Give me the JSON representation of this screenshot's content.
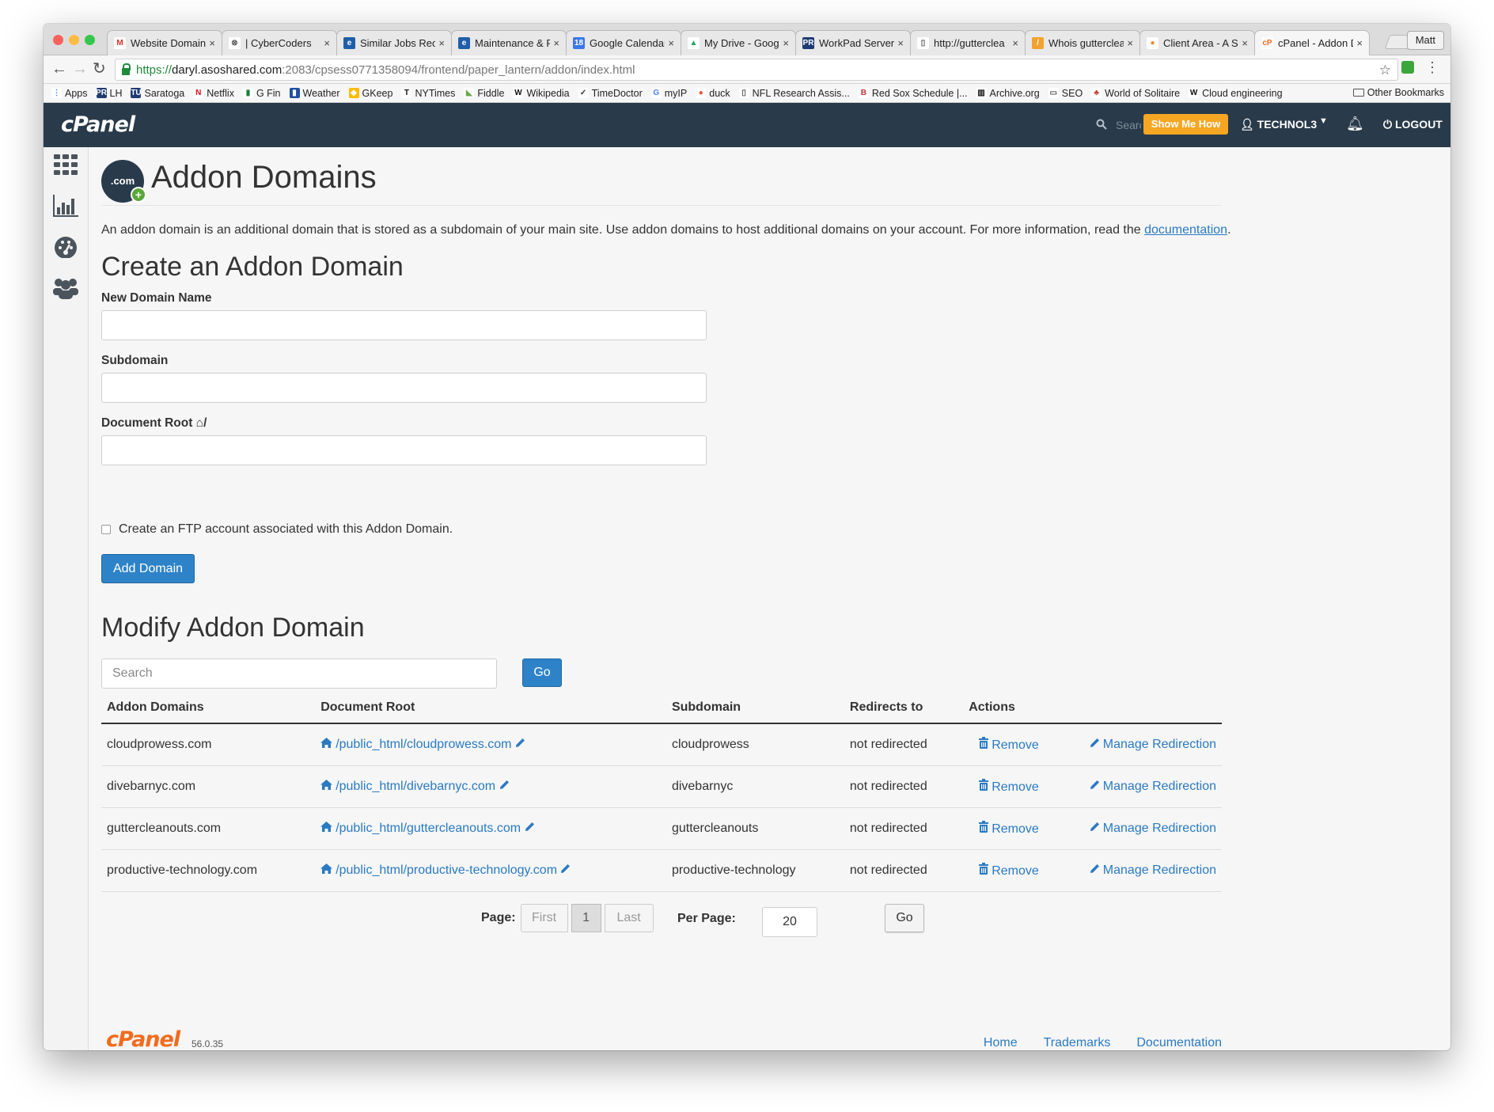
{
  "browser": {
    "tabs": [
      {
        "title": "Website Domain",
        "icon_text": "M",
        "icon_bg": "#ffffff",
        "icon_color": "#d93025"
      },
      {
        "title": "| CyberCoders",
        "icon_text": "⊗",
        "icon_bg": "#ffffff",
        "icon_color": "#555555"
      },
      {
        "title": "Similar Jobs Rec",
        "icon_text": "e",
        "icon_bg": "#1f5fa8",
        "icon_color": "#ffffff"
      },
      {
        "title": "Maintenance & F",
        "icon_text": "e",
        "icon_bg": "#1f5fa8",
        "icon_color": "#ffffff"
      },
      {
        "title": "Google Calendar",
        "icon_text": "18",
        "icon_bg": "#3b78e7",
        "icon_color": "#ffffff"
      },
      {
        "title": "My Drive - Goog",
        "icon_text": "▲",
        "icon_bg": "#ffffff",
        "icon_color": "#1da462"
      },
      {
        "title": "WorkPad Server",
        "icon_text": "PR",
        "icon_bg": "#1f3b73",
        "icon_color": "#ffffff"
      },
      {
        "title": "http://gutterclea",
        "icon_text": "▯",
        "icon_bg": "#ffffff",
        "icon_color": "#555555"
      },
      {
        "title": "Whois gutterclea",
        "icon_text": "/",
        "icon_bg": "#f2a230",
        "icon_color": "#ffffff"
      },
      {
        "title": "Client Area - A S",
        "icon_text": "●",
        "icon_bg": "#ffffff",
        "icon_color": "#f08a24"
      },
      {
        "title": "cPanel - Addon D",
        "icon_text": "cP",
        "icon_bg": "#ffffff",
        "icon_color": "#f36b1c"
      }
    ],
    "user": "Matt",
    "url": {
      "scheme": "https://",
      "host": "daryl.asoshared.com",
      "path": ":2083/cpsess0771358094/frontend/paper_lantern/addon/index.html"
    },
    "bookmarks": [
      {
        "label": "Apps",
        "icon_text": "⋮",
        "icon_bg": "#ffffff",
        "icon_color": "#4285f4"
      },
      {
        "label": "LH",
        "icon_text": "PR",
        "icon_bg": "#1f3b73",
        "icon_color": "#ffffff"
      },
      {
        "label": "Saratoga",
        "icon_text": "TU",
        "icon_bg": "#1f3b73",
        "icon_color": "#ffffff"
      },
      {
        "label": "Netflix",
        "icon_text": "N",
        "icon_bg": "#ffffff",
        "icon_color": "#e50914"
      },
      {
        "label": "G Fin",
        "icon_text": "▮",
        "icon_bg": "#ffffff",
        "icon_color": "#188038"
      },
      {
        "label": "Weather",
        "icon_text": "▮",
        "icon_bg": "#1f4fa3",
        "icon_color": "#ffffff"
      },
      {
        "label": "GKeep",
        "icon_text": "◆",
        "icon_bg": "#fbbc04",
        "icon_color": "#ffffff"
      },
      {
        "label": "NYTimes",
        "icon_text": "T",
        "icon_bg": "#ffffff",
        "icon_color": "#111111"
      },
      {
        "label": "Fiddle",
        "icon_text": "◣",
        "icon_bg": "#ffffff",
        "icon_color": "#6aa84f"
      },
      {
        "label": "Wikipedia",
        "icon_text": "W",
        "icon_bg": "#ffffff",
        "icon_color": "#111111"
      },
      {
        "label": "TimeDoctor",
        "icon_text": "✓",
        "icon_bg": "#ffffff",
        "icon_color": "#333333"
      },
      {
        "label": "myIP",
        "icon_text": "G",
        "icon_bg": "#ffffff",
        "icon_color": "#4285f4"
      },
      {
        "label": "duck",
        "icon_text": "●",
        "icon_bg": "#ffffff",
        "icon_color": "#de5833"
      },
      {
        "label": "NFL Research Assis...",
        "icon_text": "▯",
        "icon_bg": "#ffffff",
        "icon_color": "#555555"
      },
      {
        "label": "Red Sox Schedule |...",
        "icon_text": "B",
        "icon_bg": "#ffffff",
        "icon_color": "#bd3039"
      },
      {
        "label": "Archive.org",
        "icon_text": "▥",
        "icon_bg": "#ffffff",
        "icon_color": "#111111"
      },
      {
        "label": "SEO",
        "icon_text": "▭",
        "icon_bg": "#ffffff",
        "icon_color": "#555555"
      },
      {
        "label": "World of Solitaire",
        "icon_text": "♣",
        "icon_bg": "#ffffff",
        "icon_color": "#c0392b"
      },
      {
        "label": "Cloud engineering",
        "icon_text": "W",
        "icon_bg": "#ffffff",
        "icon_color": "#111111"
      }
    ],
    "other_bookmarks": "Other Bookmarks"
  },
  "header": {
    "logo": "cPanel",
    "search_placeholder": "Search",
    "show_me_how": "Show Me How",
    "username": "TECHNOL3",
    "logout": "LOGOUT"
  },
  "page": {
    "icon_text": ".com",
    "title": "Addon Domains",
    "intro": "An addon domain is an additional domain that is stored as a subdomain of your main site. Use addon domains to host additional domains on your account. For more information, read the ",
    "intro_link": "documentation",
    "intro_end": "."
  },
  "create": {
    "heading": "Create an Addon Domain",
    "new_domain_label": "New Domain Name",
    "subdomain_label": "Subdomain",
    "docroot_label": "Document Root",
    "docroot_suffix": "/",
    "ftp_label": "Create an FTP account associated with this Addon Domain.",
    "add_button": "Add Domain"
  },
  "modify": {
    "heading": "Modify Addon Domain",
    "search_placeholder": "Search",
    "go": "Go",
    "columns": [
      "Addon Domains",
      "Document Root",
      "Subdomain",
      "Redirects to",
      "Actions"
    ],
    "rows": [
      {
        "domain": "cloudprowess.com",
        "docroot": "/public_html/cloudprowess.com",
        "subdomain": "cloudprowess",
        "redirect": "not redirected",
        "remove": "Remove",
        "manage": "Manage Redirection"
      },
      {
        "domain": "divebarnyc.com",
        "docroot": "/public_html/divebarnyc.com",
        "subdomain": "divebarnyc",
        "redirect": "not redirected",
        "remove": "Remove",
        "manage": "Manage Redirection"
      },
      {
        "domain": "guttercleanouts.com",
        "docroot": "/public_html/guttercleanouts.com",
        "subdomain": "guttercleanouts",
        "redirect": "not redirected",
        "remove": "Remove",
        "manage": "Manage Redirection"
      },
      {
        "domain": "productive-technology.com",
        "docroot": "/public_html/productive-technology.com",
        "subdomain": "productive-technology",
        "redirect": "not redirected",
        "remove": "Remove",
        "manage": "Manage Redirection"
      }
    ],
    "page_label": "Page:",
    "first": "First",
    "current_page": "1",
    "last": "Last",
    "per_page_label": "Per Page:",
    "per_page_value": "20",
    "go2": "Go"
  },
  "footer": {
    "logo": "cPanel",
    "version": "56.0.35",
    "links": [
      "Home",
      "Trademarks",
      "Documentation"
    ]
  },
  "colors": {
    "header_bg": "#293a4a",
    "accent_blue": "#2e83c8",
    "show_me_how": "#f5a623",
    "brand_orange": "#f36b1c"
  }
}
